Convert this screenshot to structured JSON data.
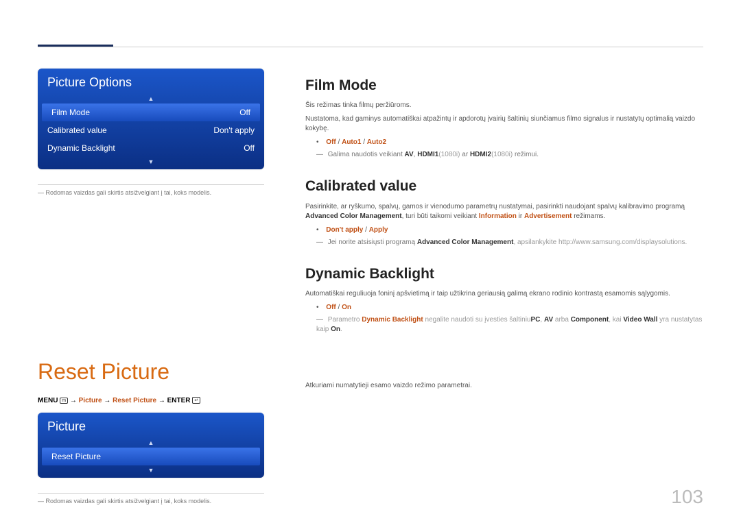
{
  "panel1": {
    "title": "Picture Options",
    "rows": [
      {
        "label": "Film Mode",
        "value": "Off"
      },
      {
        "label": "Calibrated value",
        "value": "Don't apply"
      },
      {
        "label": "Dynamic Backlight",
        "value": "Off"
      }
    ]
  },
  "leftNote1": "Rodomas vaizdas gali skirtis atsižvelgiant į tai, koks modelis.",
  "resetTitle": "Reset Picture",
  "menuPath": {
    "menu": "MENU",
    "picture": "Picture",
    "reset": "Reset Picture",
    "enter": "ENTER"
  },
  "panel2": {
    "title": "Picture",
    "rows": [
      {
        "label": "Reset Picture",
        "value": ""
      }
    ]
  },
  "leftNote2": "Rodomas vaizdas gali skirtis atsižvelgiant į tai, koks modelis.",
  "film": {
    "heading": "Film Mode",
    "p1": "Šis režimas tinka filmų peržiūroms.",
    "p2": "Nustatoma, kad gaminys automatiškai atpažintų ir apdorotų įvairių šaltinių siunčiamus filmo signalus ir nustatytų optimalią vaizdo kokybę.",
    "options": {
      "off": "Off",
      "a1": "Auto1",
      "a2": "Auto2"
    },
    "note_pre": "Galima naudotis veikiant ",
    "note_av": "AV",
    "note_mid1": ", ",
    "note_h1": "HDMI1",
    "note_h1m": "(1080i)",
    "note_mid2": " ar ",
    "note_h2": "HDMI2",
    "note_h2m": "(1080i)",
    "note_end": " režimui."
  },
  "cal": {
    "heading": "Calibrated value",
    "p1a": "Pasirinkite, ar ryškumo, spalvų, gamos ir vienodumo parametrų nustatymai, pasirinkti naudojant spalvų kalibravimo programą ",
    "p1b": "Advanced Color Management",
    "p1c": ", turi būti taikomi veikiant ",
    "p1info": "Information",
    "p1d": " ir ",
    "p1ad": "Advertisement",
    "p1e": " režimams.",
    "options": {
      "da": "Don't apply",
      "ap": "Apply"
    },
    "note_pre": "Jei norite atsisiųsti programą ",
    "note_b": "Advanced Color Management",
    "note_post": ", apsilankykite http://www.samsung.com/displaysolutions."
  },
  "dyn": {
    "heading": "Dynamic Backlight",
    "p1": "Automatiškai reguliuoja foninį apšvietimą ir taip užtikrina geriausią galimą ekrano rodinio kontrastą esamomis sąlygomis.",
    "options": {
      "off": "Off",
      "on": "On"
    },
    "note_pre": "Parametro ",
    "note_db": "Dynamic Backlight",
    "note_mid1": " negalite naudoti su įvesties šaltiniu",
    "note_pc": "PC",
    "note_c1": ", ",
    "note_av": "AV",
    "note_mid2": " arba ",
    "note_comp": "Component",
    "note_mid3": ", kai ",
    "note_vw": "Video Wall",
    "note_mid4": " yra nustatytas kaip ",
    "note_on": "On",
    "note_end": "."
  },
  "resetText": "Atkuriami numatytieji esamo vaizdo režimo parametrai.",
  "pageNumber": "103"
}
